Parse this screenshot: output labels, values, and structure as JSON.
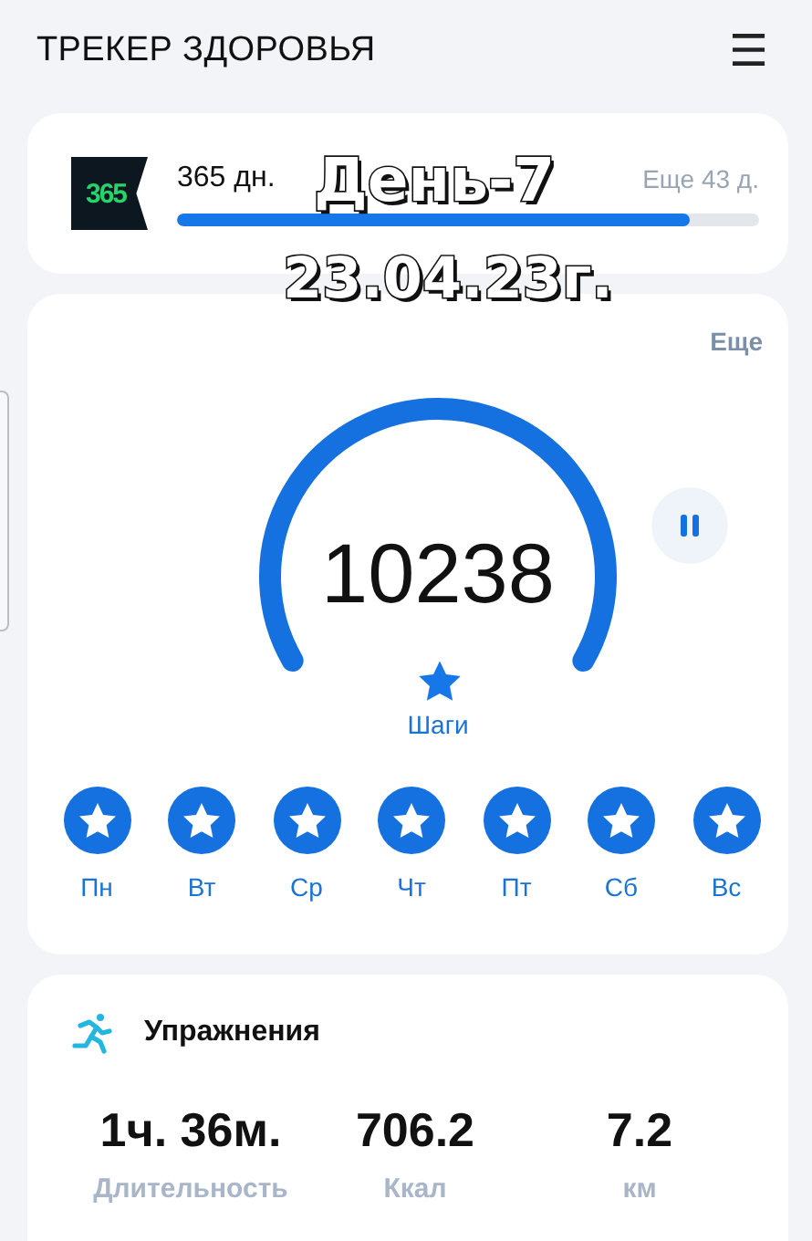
{
  "header": {
    "title": "ТРЕКЕР ЗДОРОВЬЯ",
    "menu_icon": "☰"
  },
  "goal": {
    "badge": "365",
    "label": "365 дн.",
    "remaining": "Еще 43 д.",
    "level": 0.88
  },
  "caption": {
    "line_1": "День-7",
    "line_2": "23.04.23г."
  },
  "steps": {
    "more": "Еще",
    "count": "10238",
    "unit": "Шаги",
    "days": [
      {
        "label": "Пн",
        "achieved": true
      },
      {
        "label": "Вт",
        "achieved": true
      },
      {
        "label": "Ср",
        "achieved": true
      },
      {
        "label": "Чт",
        "achieved": true
      },
      {
        "label": "Пт",
        "achieved": true
      },
      {
        "label": "Сб",
        "achieved": true
      },
      {
        "label": "Вс",
        "achieved": true
      }
    ]
  },
  "exercise": {
    "title": "Упражнения",
    "stats": [
      {
        "value": "1ч. 36м.",
        "label": "Длительность"
      },
      {
        "value": "706.2",
        "label": "Ккал"
      },
      {
        "value": "7.2",
        "label": "км"
      }
    ]
  }
}
